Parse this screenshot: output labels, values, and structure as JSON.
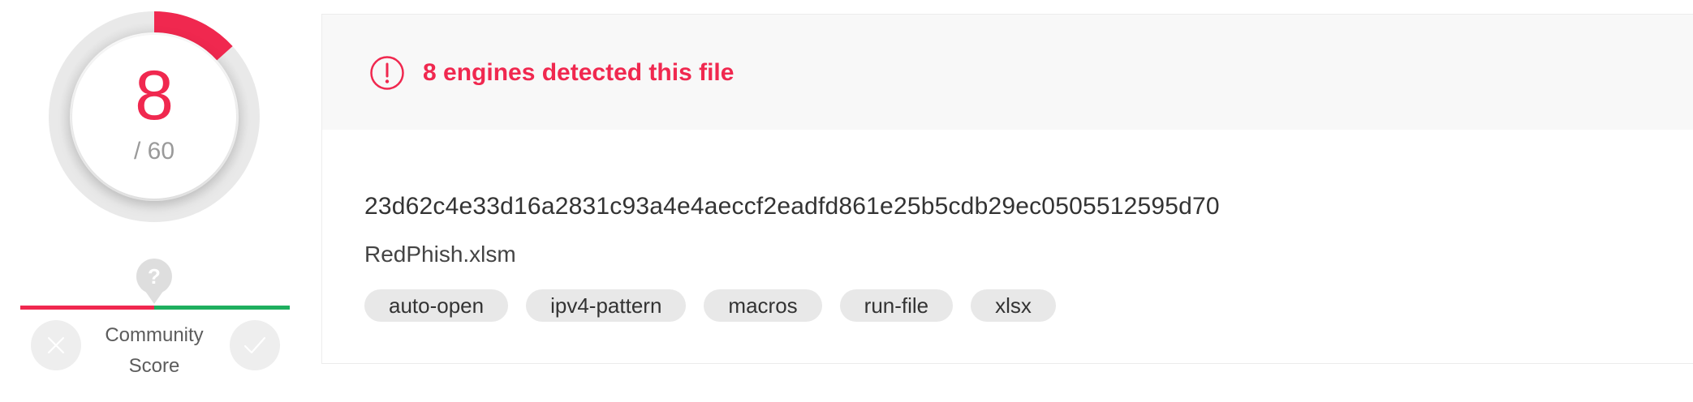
{
  "detection": {
    "positives": "8",
    "total_label": "/ 60",
    "fraction": 0.1333,
    "accent_color": "#f0284f"
  },
  "community": {
    "label_line1": "Community",
    "label_line2": "Score",
    "marker_glyph": "?",
    "negative_color": "#f0284f",
    "positive_color": "#1eaf5f"
  },
  "alert": {
    "text": "8 engines detected this file",
    "icon": "exclamation-circle-icon"
  },
  "file": {
    "hash": "23d62c4e33d16a2831c93a4e4aeccf2eadfd861e25b5cdb29ec0505512595d70",
    "name": "RedPhish.xlsm",
    "tags": [
      "auto-open",
      "ipv4-pattern",
      "macros",
      "run-file",
      "xlsx"
    ]
  }
}
